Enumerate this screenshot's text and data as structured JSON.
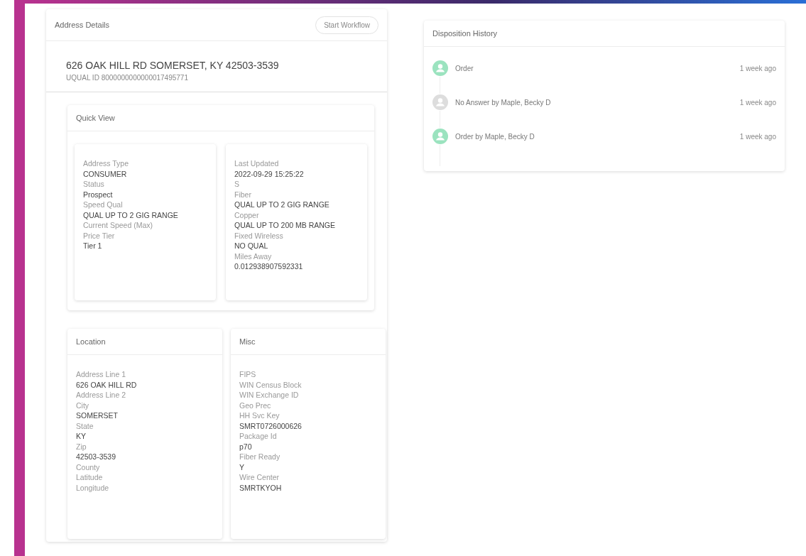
{
  "address_details": {
    "title": "Address Details",
    "action": "Start Workflow",
    "address": "626 OAK HILL RD SOMERSET, KY 42503-3539",
    "uqual_id": "UQUAL ID 8000000000000017495771",
    "quick_view": {
      "title": "Quick View",
      "columns": [
        [
          {
            "kind": "label",
            "text": "Address Type"
          },
          {
            "kind": "value",
            "text": "CONSUMER"
          },
          {
            "kind": "label",
            "text": "Status"
          },
          {
            "kind": "value",
            "text": "Prospect"
          },
          {
            "kind": "label",
            "text": "Speed Qual"
          },
          {
            "kind": "value",
            "text": "QUAL UP TO 2 GIG RANGE"
          },
          {
            "kind": "label",
            "text": "Current Speed (Max)"
          },
          {
            "kind": "label",
            "text": "Price Tier"
          },
          {
            "kind": "value",
            "text": "Tier 1"
          }
        ],
        [
          {
            "kind": "label",
            "text": "Last Updated"
          },
          {
            "kind": "value",
            "text": "2022-09-29 15:25:22"
          },
          {
            "kind": "label",
            "text": "S"
          },
          {
            "kind": "label",
            "text": "Fiber"
          },
          {
            "kind": "value",
            "text": "QUAL UP TO 2 GIG RANGE"
          },
          {
            "kind": "label",
            "text": "Copper"
          },
          {
            "kind": "value",
            "text": "QUAL UP TO 200 MB RANGE"
          },
          {
            "kind": "label",
            "text": "Fixed Wireless"
          },
          {
            "kind": "value",
            "text": "NO QUAL"
          },
          {
            "kind": "label",
            "text": "Miles Away"
          },
          {
            "kind": "value",
            "text": "0.012938907592331"
          }
        ]
      ]
    },
    "sections": [
      {
        "title": "Location",
        "fields": [
          {
            "kind": "label",
            "text": "Address Line 1"
          },
          {
            "kind": "value",
            "text": "626 OAK HILL RD"
          },
          {
            "kind": "label",
            "text": "Address Line 2"
          },
          {
            "kind": "label",
            "text": "City"
          },
          {
            "kind": "value",
            "text": "SOMERSET"
          },
          {
            "kind": "label",
            "text": "State"
          },
          {
            "kind": "value",
            "text": "KY"
          },
          {
            "kind": "label",
            "text": "Zip"
          },
          {
            "kind": "value",
            "text": "42503-3539"
          },
          {
            "kind": "label",
            "text": "County"
          },
          {
            "kind": "label",
            "text": "Latitude"
          },
          {
            "kind": "label",
            "text": "Longitude"
          }
        ]
      },
      {
        "title": "Misc",
        "fields": [
          {
            "kind": "label",
            "text": "FIPS"
          },
          {
            "kind": "label",
            "text": "WIN Census Block"
          },
          {
            "kind": "label",
            "text": "WIN Exchange ID"
          },
          {
            "kind": "label",
            "text": "Geo Prec"
          },
          {
            "kind": "label",
            "text": "HH Svc Key"
          },
          {
            "kind": "value",
            "text": "SMRT0726000626"
          },
          {
            "kind": "label",
            "text": "Package Id"
          },
          {
            "kind": "value",
            "text": "p70"
          },
          {
            "kind": "label",
            "text": "Fiber Ready"
          },
          {
            "kind": "value",
            "text": "Y"
          },
          {
            "kind": "label",
            "text": "Wire Center"
          },
          {
            "kind": "value",
            "text": "SMRTKYOH"
          }
        ]
      }
    ]
  },
  "disposition_history": {
    "title": "Disposition History",
    "items": [
      {
        "text": "Order",
        "time": "1 week ago",
        "color": "#9be3bf"
      },
      {
        "text": "No Answer by Maple, Becky D",
        "time": "1 week ago",
        "color": "#dddddd"
      },
      {
        "text": "Order by Maple, Becky D",
        "time": "1 week ago",
        "color": "#9be3bf"
      }
    ]
  }
}
